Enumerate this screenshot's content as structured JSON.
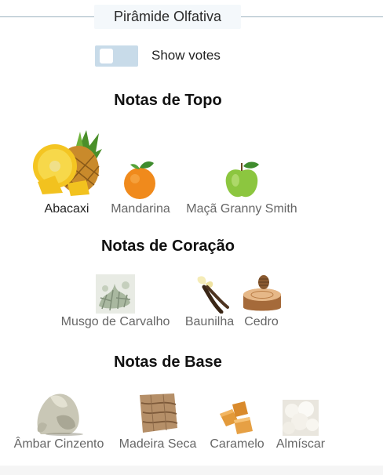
{
  "header": {
    "title": "Pirâmide Olfativa"
  },
  "votes_toggle": {
    "label": "Show votes",
    "on": false
  },
  "sections": [
    {
      "title": "Notas de Topo",
      "notes": [
        {
          "label": "Abacaxi",
          "icon": "pineapple-icon"
        },
        {
          "label": "Mandarina",
          "icon": "mandarin-icon"
        },
        {
          "label": "Maçã Granny Smith",
          "icon": "green-apple-icon"
        }
      ]
    },
    {
      "title": "Notas de Coração",
      "notes": [
        {
          "label": "Musgo de Carvalho",
          "icon": "oakmoss-icon"
        },
        {
          "label": "Baunilha",
          "icon": "vanilla-icon"
        },
        {
          "label": "Cedro",
          "icon": "cedar-icon"
        }
      ]
    },
    {
      "title": "Notas de Base",
      "notes": [
        {
          "label": "Âmbar Cinzento",
          "icon": "ambergris-icon"
        },
        {
          "label": "Madeira Seca",
          "icon": "dry-wood-icon"
        },
        {
          "label": "Caramelo",
          "icon": "caramel-icon"
        },
        {
          "label": "Almíscar",
          "icon": "musk-icon"
        }
      ]
    }
  ],
  "colors": {
    "header_line": "#9db3bf",
    "toggle_track": "#c8dbe9",
    "label_muted": "#666666"
  }
}
